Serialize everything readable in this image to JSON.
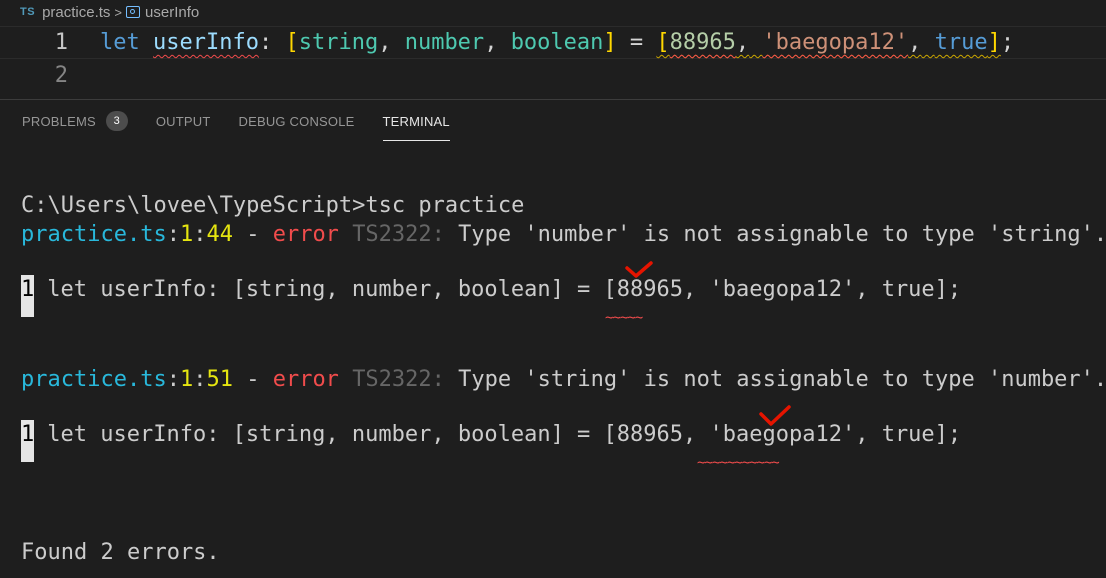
{
  "breadcrumb": {
    "file_icon_text": "TS",
    "file_name": "practice.ts",
    "separator": ">",
    "symbol_name": "userInfo"
  },
  "editor": {
    "lines": [
      {
        "number": "1"
      },
      {
        "number": "2"
      }
    ],
    "code": {
      "kw_let": "let",
      "var_name": "userInfo",
      "colon": ":",
      "open_bracket": "[",
      "t_string": "string",
      "comma1": ",",
      "t_number": "number",
      "comma2": ",",
      "t_boolean": "boolean",
      "close_bracket": "]",
      "equals": "=",
      "v_open": "[",
      "v_num": "88965",
      "v_comma1": ",",
      "v_str": "'baegopa12'",
      "v_comma2": ",",
      "v_true": "true",
      "v_close": "]",
      "semicolon": ";"
    }
  },
  "panel": {
    "tabs": [
      {
        "label": "PROBLEMS",
        "badge": "3"
      },
      {
        "label": "OUTPUT"
      },
      {
        "label": "DEBUG CONSOLE"
      },
      {
        "label": "TERMINAL"
      }
    ]
  },
  "terminal": {
    "prompt_line": "C:\\Users\\lovee\\TypeScript>tsc practice",
    "errors": [
      {
        "file": "practice.ts",
        "loc_sep1": ":",
        "line": "1",
        "loc_sep2": ":",
        "col": "44",
        "dash": " - ",
        "level": "error",
        "code": "TS2322:",
        "message": "Type 'number' is not assignable to type 'string'.",
        "snippet_line_no": "1",
        "snippet": "let userInfo: [string, number, boolean] = [88965, 'baegopa12', true];",
        "tildes": "~~~~~"
      },
      {
        "file": "practice.ts",
        "loc_sep1": ":",
        "line": "1",
        "loc_sep2": ":",
        "col": "51",
        "dash": " - ",
        "level": "error",
        "code": "TS2322:",
        "message": "Type 'string' is not assignable to type 'number'.",
        "snippet_line_no": "1",
        "snippet": "let userInfo: [string, number, boolean] = [88965, 'baegopa12', true];",
        "tildes": "~~~~~~~~~~~"
      }
    ],
    "summary": "Found 2 errors.",
    "annotation_color": "#e51400"
  }
}
